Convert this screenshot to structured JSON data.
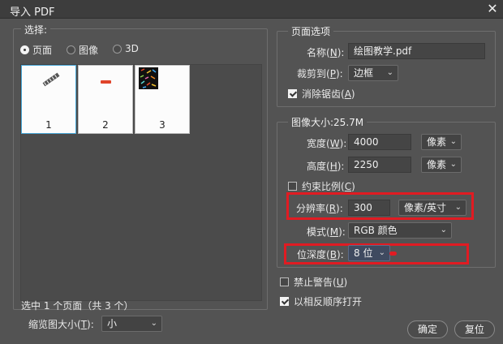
{
  "window": {
    "title": "导入 PDF",
    "close_glyph": "✕"
  },
  "select_group": {
    "legend": "选择:",
    "options": [
      {
        "label": "页面",
        "checked": true
      },
      {
        "label": "图像",
        "checked": false
      },
      {
        "label": "3D",
        "checked": false
      }
    ],
    "thumbnails": [
      {
        "number": "1",
        "selected": true
      },
      {
        "number": "2",
        "selected": false
      },
      {
        "number": "3",
        "selected": false
      }
    ],
    "selection_status": "选中 1 个页面（共 3 个）",
    "thumb_size_label": "缩览图大小",
    "thumb_size_hotkey": "T",
    "thumb_size_value": "小"
  },
  "page_options": {
    "legend": "页面选项",
    "name_label": "名称",
    "name_hotkey": "N",
    "name_value": "绘图教学.pdf",
    "crop_label": "裁剪到",
    "crop_hotkey": "P",
    "crop_value": "边框",
    "antialias_label": "消除锯齿",
    "antialias_hotkey": "A",
    "antialias_checked": true
  },
  "image_size": {
    "legend": "图像大小:25.7M",
    "width_label": "宽度",
    "width_hotkey": "W",
    "width_value": "4000",
    "width_unit": "像素",
    "height_label": "高度",
    "height_hotkey": "H",
    "height_value": "2250",
    "height_unit": "像素",
    "constrain_label": "约束比例",
    "constrain_hotkey": "C",
    "constrain_checked": false,
    "resolution_label": "分辨率",
    "resolution_hotkey": "R",
    "resolution_value": "300",
    "resolution_unit": "像素/英寸",
    "mode_label": "模式",
    "mode_hotkey": "M",
    "mode_value": "RGB 颜色",
    "depth_label": "位深度",
    "depth_hotkey": "B",
    "depth_value": "8 位"
  },
  "bottom_options": {
    "suppress_label": "禁止警告",
    "suppress_hotkey": "U",
    "suppress_checked": false,
    "reverse_label": "以相反顺序打开",
    "reverse_checked": true
  },
  "buttons": {
    "ok": "确定",
    "reset": "复位"
  },
  "colors": {
    "highlight_box": "#e11b22",
    "selected_thumb_border": "#49a8d8"
  }
}
